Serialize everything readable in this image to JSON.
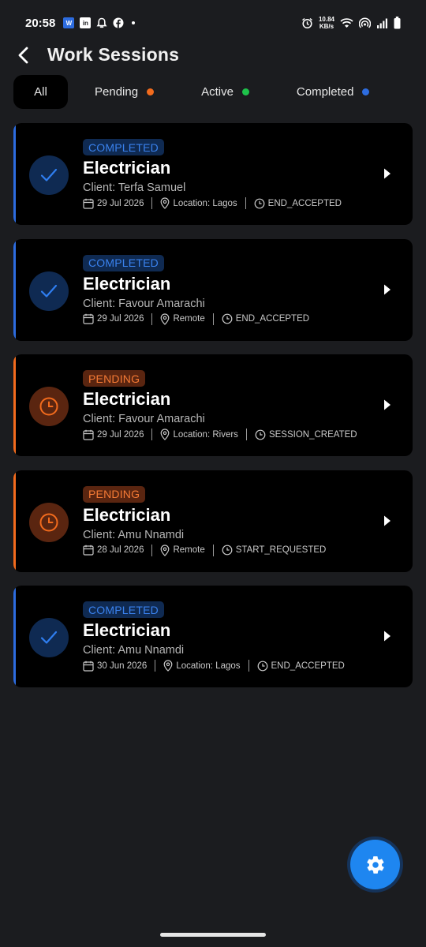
{
  "status_bar": {
    "time": "20:58",
    "left_icons": [
      "w-app-icon",
      "linkedin-icon",
      "notification-bell-icon",
      "facebook-icon"
    ],
    "net_speed_value": "10.84",
    "net_speed_unit": "KB/s",
    "right_icons": [
      "alarm-icon",
      "wifi-icon",
      "hotspot-icon",
      "signal-icon",
      "battery-icon"
    ]
  },
  "header": {
    "title": "Work Sessions",
    "back_icon": "chevron-left-icon"
  },
  "tabs": [
    {
      "label": "All",
      "selected": true
    },
    {
      "label": "Pending",
      "dot_color": "#f26b1d"
    },
    {
      "label": "Active",
      "dot_color": "#1ec24a"
    },
    {
      "label": "Completed",
      "dot_color": "#2d6cdf"
    }
  ],
  "colors": {
    "completed": "#2d6cdf",
    "pending": "#f26b1d",
    "fab": "#1e86f0",
    "background": "#1b1c1f",
    "card": "#000000"
  },
  "sessions": [
    {
      "status": "COMPLETED",
      "status_type": "completed",
      "title": "Electrician",
      "client": "Client: Terfa Samuel",
      "date": "29 Jul 2026",
      "location": "Location: Lagos",
      "stage": "END_ACCEPTED"
    },
    {
      "status": "COMPLETED",
      "status_type": "completed",
      "title": "Electrician",
      "client": "Client: Favour Amarachi",
      "date": "29 Jul 2026",
      "location": "Remote",
      "stage": "END_ACCEPTED"
    },
    {
      "status": "PENDING",
      "status_type": "pending",
      "title": "Electrician",
      "client": "Client: Favour Amarachi",
      "date": "29 Jul 2026",
      "location": "Location: Rivers",
      "stage": "SESSION_CREATED"
    },
    {
      "status": "PENDING",
      "status_type": "pending",
      "title": "Electrician",
      "client": "Client: Amu Nnamdi",
      "date": "28 Jul 2026",
      "location": "Remote",
      "stage": "START_REQUESTED"
    },
    {
      "status": "COMPLETED",
      "status_type": "completed",
      "title": "Electrician",
      "client": "Client: Amu Nnamdi",
      "date": "30 Jun 2026",
      "location": "Location: Lagos",
      "stage": "END_ACCEPTED"
    }
  ],
  "fab": {
    "icon": "gear-icon"
  }
}
